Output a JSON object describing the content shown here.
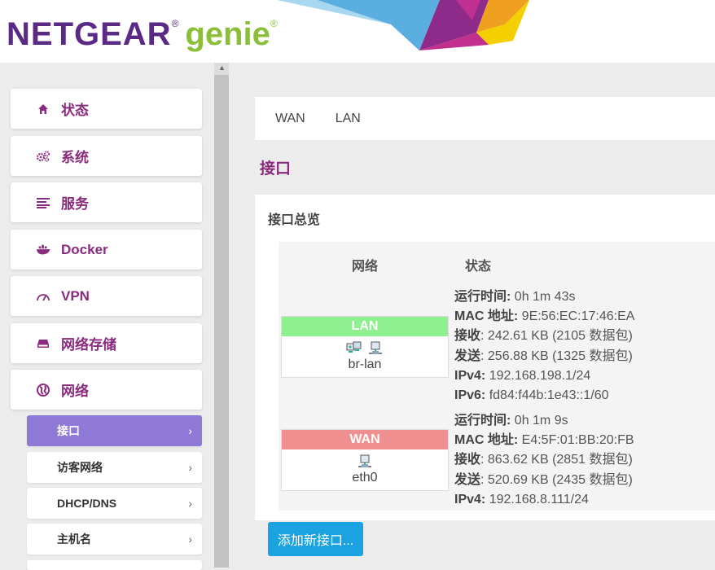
{
  "header": {
    "logo_netgear": "NETGEAR",
    "logo_genie": "genie",
    "reg_mark": "®"
  },
  "sidebar": {
    "items": [
      {
        "label": "状态",
        "icon": "home-icon"
      },
      {
        "label": "系统",
        "icon": "gears-icon"
      },
      {
        "label": "服务",
        "icon": "list-icon"
      },
      {
        "label": "Docker",
        "icon": "docker-icon"
      },
      {
        "label": "VPN",
        "icon": "gauge-icon"
      },
      {
        "label": "网络存储",
        "icon": "drive-icon"
      },
      {
        "label": "网络",
        "icon": "globe-icon"
      }
    ],
    "subitems": [
      {
        "label": "接口",
        "active": true
      },
      {
        "label": "访客网络",
        "active": false
      },
      {
        "label": "DHCP/DNS",
        "active": false
      },
      {
        "label": "主机名",
        "active": false
      }
    ],
    "chevron": "›",
    "scroll_up": "▲"
  },
  "tabs": [
    {
      "label": "WAN"
    },
    {
      "label": "LAN"
    }
  ],
  "page_title": "接口",
  "panel": {
    "title": "接口总览",
    "col_network": "网络",
    "col_status": "状态"
  },
  "interfaces": [
    {
      "name": "LAN",
      "device": "br-lan",
      "name_color": "#8ff08f",
      "status": [
        {
          "label": "运行时间:",
          "value": " 0h 1m 43s"
        },
        {
          "label": "MAC 地址:",
          "value": " 9E:56:EC:17:46:EA"
        },
        {
          "label": "接收",
          "value": ": 242.61 KB (2105 数据包)"
        },
        {
          "label": "发送",
          "value": ": 256.88 KB (1325 数据包)"
        },
        {
          "label": "IPv4:",
          "value": " 192.168.198.1/24"
        },
        {
          "label": "IPv6:",
          "value": " fd84:f44b:1e43::1/60"
        }
      ]
    },
    {
      "name": "WAN",
      "device": "eth0",
      "name_color": "#f08f8f",
      "status": [
        {
          "label": "运行时间:",
          "value": " 0h 1m 9s"
        },
        {
          "label": "MAC 地址:",
          "value": " E4:5F:01:BB:20:FB"
        },
        {
          "label": "接收",
          "value": ": 863.62 KB (2851 数据包)"
        },
        {
          "label": "发送",
          "value": ": 520.69 KB (2435 数据包)"
        },
        {
          "label": "IPv4:",
          "value": " 192.168.8.111/24"
        }
      ]
    }
  ],
  "add_button": "添加新接口...",
  "colors": {
    "accent_purple": "#8a2b7e",
    "active_sub": "#8e79d6",
    "button_blue": "#1aa3e0"
  }
}
